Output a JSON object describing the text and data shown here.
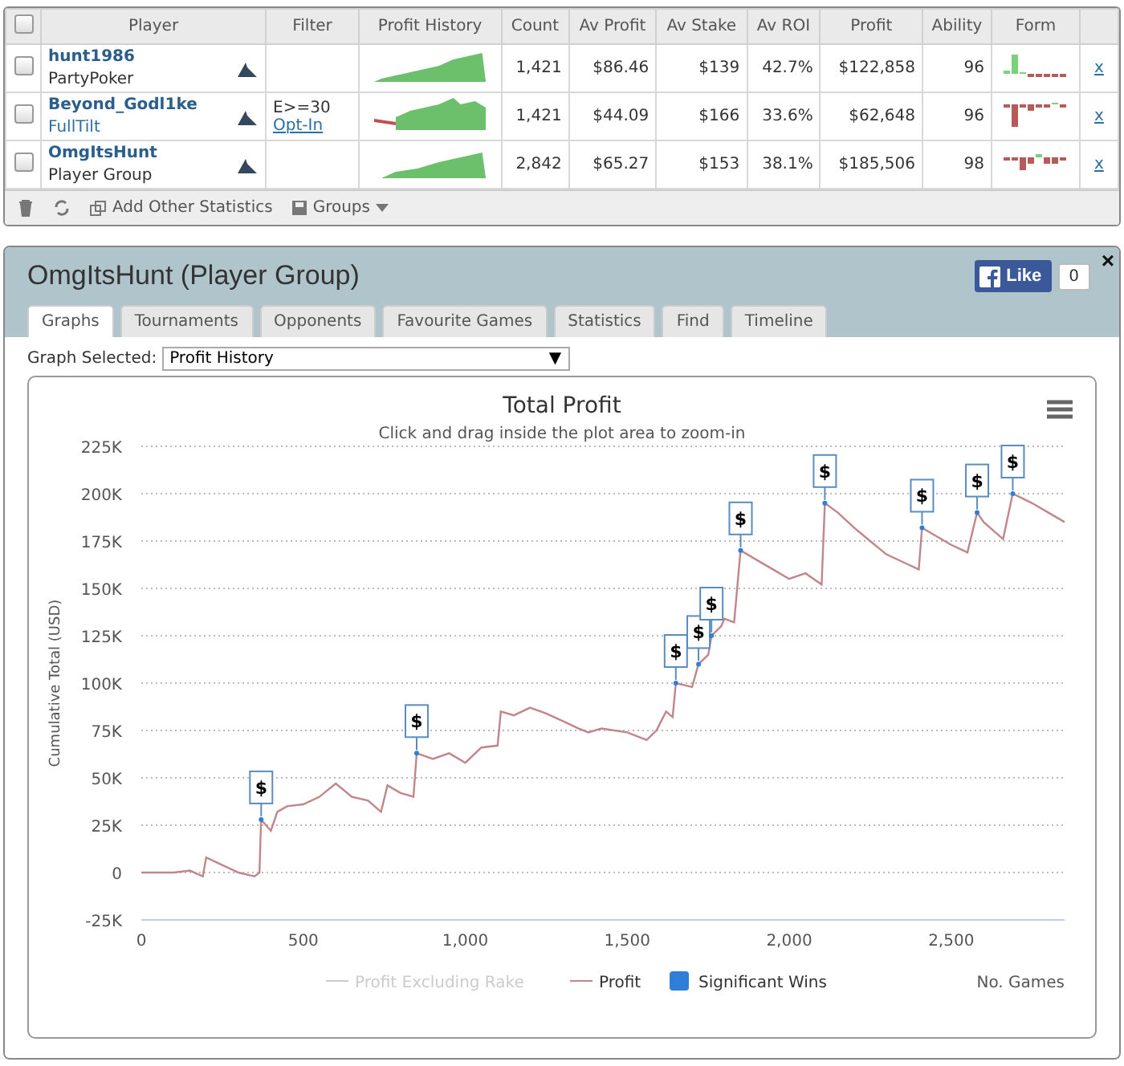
{
  "player_table": {
    "columns": [
      "Player",
      "Filter",
      "Profit History",
      "Count",
      "Av Profit",
      "Av Stake",
      "Av ROI",
      "Profit",
      "Ability",
      "Form"
    ],
    "select_all": {
      "checked": false
    },
    "rows": [
      {
        "checked": false,
        "name": "hunt1986",
        "site": "PartyPoker",
        "site_link": false,
        "filter": null,
        "count": "1,421",
        "av_profit": "$86.46",
        "av_stake": "$139",
        "av_roi": "42.7%",
        "profit": "$122,858",
        "ability": "96",
        "remove": "x"
      },
      {
        "checked": false,
        "name": "Beyond_Godl1ke",
        "site": "FullTilt",
        "site_link": true,
        "filter": {
          "text": "E>=30",
          "link": "Opt-In"
        },
        "count": "1,421",
        "av_profit": "$44.09",
        "av_stake": "$166",
        "av_roi": "33.6%",
        "profit": "$62,648",
        "ability": "96",
        "remove": "x"
      },
      {
        "checked": false,
        "name": "OmgItsHunt",
        "site": "Player Group",
        "site_link": false,
        "filter": null,
        "count": "2,842",
        "av_profit": "$65.27",
        "av_stake": "$153",
        "av_roi": "38.1%",
        "profit": "$185,506",
        "ability": "98",
        "remove": "x"
      }
    ],
    "footer": {
      "add_label": "Add Other Statistics",
      "groups_label": "Groups"
    }
  },
  "panel": {
    "title": "OmgItsHunt (Player Group)",
    "close": "×",
    "like": {
      "label": "Like",
      "count": "0"
    },
    "tabs": [
      {
        "label": "Graphs",
        "selected": true
      },
      {
        "label": "Tournaments",
        "selected": false
      },
      {
        "label": "Opponents",
        "selected": false
      },
      {
        "label": "Favourite Games",
        "selected": false
      },
      {
        "label": "Statistics",
        "selected": false
      },
      {
        "label": "Find",
        "selected": false
      },
      {
        "label": "Timeline",
        "selected": false
      }
    ],
    "graph_select": {
      "label": "Graph Selected:",
      "value": "Profit History",
      "arrow": "▼"
    },
    "chart": {
      "subtitle": "Click and drag inside the plot area to zoom-in",
      "hidden_legend": {
        "label": "Profit Excluding Rake",
        "enabled": false
      },
      "flag_symbol": "$",
      "chart_data": {
        "type": "line",
        "title": "Total Profit",
        "xlabel": "No. Games",
        "ylabel": "Cumulative Total (USD)",
        "xlim": [
          0,
          2850
        ],
        "ylim": [
          -25000,
          225000
        ],
        "grid": true,
        "legend": true,
        "xticks": [
          {
            "value": 0,
            "label": "0"
          },
          {
            "value": 500,
            "label": "500"
          },
          {
            "value": 1000,
            "label": "1,000"
          },
          {
            "value": 1500,
            "label": "1,500"
          },
          {
            "value": 2000,
            "label": "2,000"
          },
          {
            "value": 2500,
            "label": "2,500"
          }
        ],
        "yticks": [
          {
            "value": -25000,
            "label": "-25K"
          },
          {
            "value": 0,
            "label": "0"
          },
          {
            "value": 25000,
            "label": "25K"
          },
          {
            "value": 50000,
            "label": "50K"
          },
          {
            "value": 75000,
            "label": "75K"
          },
          {
            "value": 100000,
            "label": "100K"
          },
          {
            "value": 125000,
            "label": "125K"
          },
          {
            "value": 150000,
            "label": "150K"
          },
          {
            "value": 175000,
            "label": "175K"
          },
          {
            "value": 200000,
            "label": "200K"
          },
          {
            "value": 225000,
            "label": "225K"
          }
        ],
        "x": [
          0,
          100,
          150,
          190,
          200,
          250,
          300,
          350,
          365,
          370,
          400,
          420,
          450,
          500,
          550,
          600,
          650,
          700,
          740,
          760,
          800,
          840,
          850,
          900,
          950,
          1000,
          1050,
          1100,
          1110,
          1150,
          1200,
          1250,
          1300,
          1350,
          1380,
          1420,
          1500,
          1560,
          1590,
          1620,
          1640,
          1650,
          1700,
          1720,
          1750,
          1760,
          1790,
          1800,
          1830,
          1850,
          1900,
          1950,
          2000,
          2050,
          2100,
          2110,
          2150,
          2200,
          2250,
          2300,
          2350,
          2400,
          2410,
          2450,
          2500,
          2550,
          2580,
          2600,
          2660,
          2690,
          2750,
          2800,
          2850
        ],
        "series": [
          {
            "name": "Profit",
            "color": "#c0868a",
            "values": [
              0,
              0,
              1000,
              -2000,
              8000,
              4000,
              0,
              -2000,
              0,
              28000,
              22000,
              32000,
              35000,
              36000,
              40000,
              47000,
              40000,
              38000,
              32000,
              46000,
              42000,
              40000,
              63000,
              60000,
              63000,
              58000,
              66000,
              67000,
              85000,
              83000,
              87000,
              84000,
              80000,
              76000,
              74000,
              76000,
              74000,
              70000,
              75000,
              85000,
              82000,
              100000,
              98000,
              110000,
              115000,
              125000,
              130000,
              134000,
              132000,
              170000,
              165000,
              160000,
              155000,
              158000,
              152000,
              195000,
              190000,
              182000,
              175000,
              168000,
              164000,
              160000,
              182000,
              178000,
              173000,
              169000,
              190000,
              185000,
              176000,
              200000,
              195000,
              190000,
              185000
            ]
          },
          {
            "name": "Significant Wins",
            "color": "#2f7ed8",
            "marker": "circle",
            "values": [
              null,
              null,
              null,
              null,
              null,
              null,
              null,
              null,
              null,
              28000,
              null,
              null,
              null,
              null,
              null,
              null,
              null,
              null,
              null,
              null,
              null,
              null,
              63000,
              null,
              null,
              null,
              null,
              null,
              null,
              null,
              null,
              null,
              null,
              null,
              null,
              null,
              null,
              null,
              null,
              null,
              null,
              100000,
              null,
              110000,
              null,
              125000,
              null,
              null,
              null,
              170000,
              null,
              null,
              null,
              null,
              null,
              195000,
              null,
              null,
              null,
              null,
              null,
              null,
              182000,
              null,
              null,
              null,
              190000,
              null,
              null,
              200000,
              null,
              null,
              null
            ]
          }
        ]
      }
    }
  }
}
